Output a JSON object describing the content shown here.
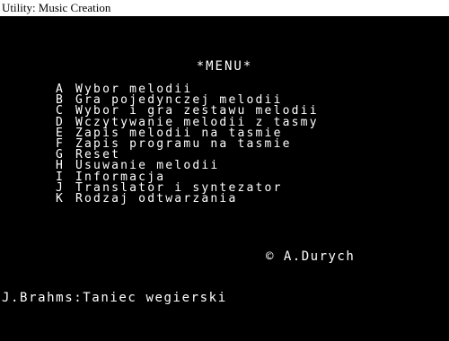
{
  "caption": "Utility: Music Creation",
  "menu": {
    "title": "*MENU*",
    "items": [
      {
        "key": "A",
        "label": "Wybor melodii"
      },
      {
        "key": "B",
        "label": "Gra pojedynczej melodii"
      },
      {
        "key": "C",
        "label": "Wybor i gra zestawu melodii"
      },
      {
        "key": "D",
        "label": "Wczytywanie melodii z tasmy"
      },
      {
        "key": "E",
        "label": "Zapis melodii na tasmie"
      },
      {
        "key": "F",
        "label": "Zapis programu na tasmie"
      },
      {
        "key": "G",
        "label": "Reset"
      },
      {
        "key": "H",
        "label": "Usuwanie melodii"
      },
      {
        "key": "I",
        "label": "Informacja"
      },
      {
        "key": "J",
        "label": "Translator i syntezator"
      },
      {
        "key": "K",
        "label": "Rodzaj odtwarzania"
      }
    ]
  },
  "copyright": "© A.Durych",
  "now_playing": "J.Brahms:Taniec wegierski",
  "colors": {
    "screen_background": "#000000",
    "screen_text": "#ffffff"
  }
}
